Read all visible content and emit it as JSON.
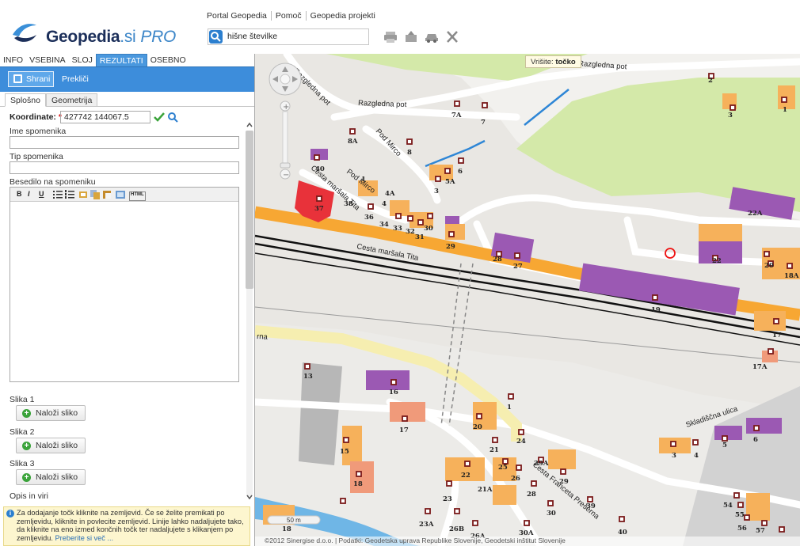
{
  "header": {
    "logo": {
      "name": "Geopedia",
      "suffix": ".si",
      "edition": "PRO"
    },
    "links": [
      "Portal Geopedia",
      "Pomoč",
      "Geopedia projekti"
    ],
    "search": {
      "value": "hišne številke"
    },
    "tools": [
      "print-icon",
      "export-icon",
      "car-icon",
      "tools-icon"
    ]
  },
  "panel": {
    "tabs": [
      "INFO",
      "VSEBINA",
      "SLOJ",
      "REZULTATI",
      "OSEBNO"
    ],
    "active_tab": "REZULTATI",
    "actions": {
      "save": "Shrani",
      "cancel": "Prekliči"
    },
    "subtabs": [
      "Splošno",
      "Geometrija"
    ],
    "form": {
      "coord_label": "Koordinate:",
      "coord_required": "*",
      "coord_value": "427742 144067.5",
      "name_label": "Ime spomenika",
      "type_label": "Tip spomenika",
      "text_label": "Besedilo na spomeniku",
      "editor_buttons": [
        "B",
        "I",
        "U",
        "HTML"
      ],
      "images": [
        {
          "label": "Slika 1",
          "button": "Naloži sliko"
        },
        {
          "label": "Slika 2",
          "button": "Naloži sliko"
        },
        {
          "label": "Slika 3",
          "button": "Naloži sliko"
        }
      ],
      "sources_label": "Opis in viri"
    },
    "info": {
      "text": "Za dodajanje točk kliknite na zemljevid. Če se želite premikati po zemljevidu, kliknite in povlecite zemljevid. Linije lahko nadaljujete tako, da kliknite na eno izmed končnih točk ter nadaljujete s klikanjem po zemljevidu.",
      "more": "Preberite si več ..."
    }
  },
  "map": {
    "tooltip_label": "Vrišite:",
    "tooltip_value": "točko",
    "scale": "50 m",
    "copyright": "©2012 Sinergise d.o.o. | Podatki: Geodetska uprava Republike Slovenije, Geodetski inštitut Slovenije",
    "streets": [
      "Razgledna pot",
      "Razgledna pot",
      "Razgledna pot",
      "Pod Mirco",
      "Pod Mirco",
      "Cesta maršala Tita",
      "Cesta maršala Tita",
      "Skladiščna ulica",
      "Cesta Franceta Prešerna",
      "rna"
    ],
    "house_numbers": [
      "2",
      "3",
      "1",
      "7A",
      "7",
      "8A",
      "8",
      "6",
      "5A",
      "1",
      "3",
      "4A",
      "40",
      "4",
      "37",
      "38",
      "36",
      "34",
      "33",
      "32",
      "31",
      "30",
      "29",
      "28",
      "27",
      "22A",
      "22",
      "20",
      "18A",
      "19",
      "17",
      "17A",
      "13",
      "16",
      "17",
      "1",
      "20",
      "24",
      "21",
      "22",
      "25",
      "26",
      "29A",
      "29",
      "21A",
      "28",
      "23",
      "39",
      "30",
      "15",
      "18",
      "18",
      "23A",
      "26B",
      "26A",
      "30A",
      "40",
      "3",
      "4",
      "5",
      "6",
      "54",
      "55",
      "56",
      "57"
    ]
  },
  "colors": {
    "accent": "#3d8ddb",
    "selected_building": "#e8323a",
    "residential": "#f6b15b",
    "industrial": "#9b59b3",
    "main_road": "#f7a733",
    "green": "#d4e9a9",
    "water": "#6fb6e6"
  }
}
